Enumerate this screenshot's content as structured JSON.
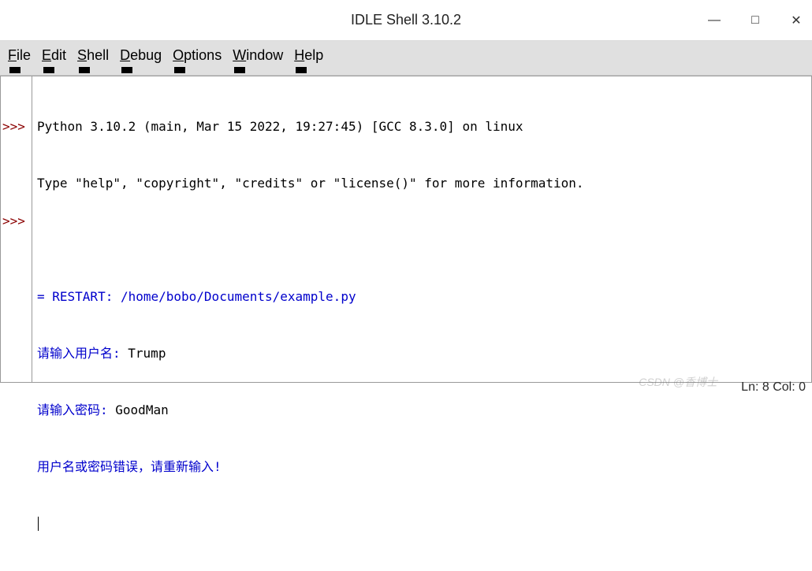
{
  "window": {
    "title": "IDLE Shell 3.10.2",
    "minimize": "—",
    "maximize": "□",
    "close": "✕"
  },
  "menubar": {
    "items": [
      {
        "label": "File",
        "accel": "F"
      },
      {
        "label": "Edit",
        "accel": "E"
      },
      {
        "label": "Shell",
        "accel": "S"
      },
      {
        "label": "Debug",
        "accel": "D"
      },
      {
        "label": "Options",
        "accel": "O"
      },
      {
        "label": "Window",
        "accel": "W"
      },
      {
        "label": "Help",
        "accel": "H"
      }
    ]
  },
  "shell": {
    "prompt": ">>>",
    "lines": [
      {
        "type": "plain",
        "text": "Python 3.10.2 (main, Mar 15 2022, 19:27:45) [GCC 8.3.0] on linux"
      },
      {
        "type": "plain",
        "text": "Type \"help\", \"copyright\", \"credits\" or \"license()\" for more information."
      },
      {
        "type": "prompt",
        "text": ""
      },
      {
        "type": "blue",
        "text": "= RESTART: /home/bobo/Documents/example.py"
      },
      {
        "type": "mixed",
        "prefix": "请输入用户名: ",
        "user": "Trump"
      },
      {
        "type": "mixed",
        "prefix": "请输入密码: ",
        "user": "GoodMan"
      },
      {
        "type": "blue",
        "text": "用户名或密码错误，请重新输入!"
      },
      {
        "type": "prompt-cursor",
        "text": ""
      }
    ]
  },
  "statusbar": {
    "line": "8",
    "col": "0",
    "text": "Ln: 8 Col: 0"
  },
  "watermark": "CSDN @香博士"
}
